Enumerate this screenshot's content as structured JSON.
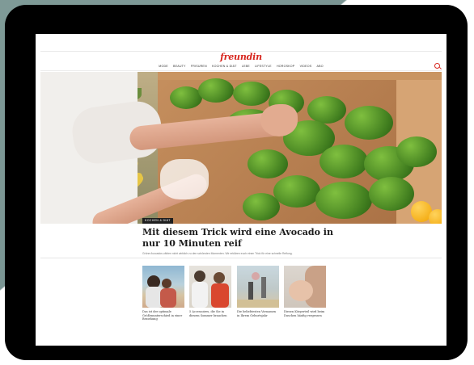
{
  "site": {
    "logo": "freundin",
    "nav": [
      "MODE",
      "BEAUTY",
      "FRISUREN",
      "KOCHEN & DIÄT",
      "LEBE",
      "LIFESTYLE",
      "HOROSKOP",
      "VIDEOS",
      "ABO"
    ]
  },
  "article": {
    "category": "KOCHEN & DIÄT",
    "headline": "Mit diesem Trick wird eine Avocado in nur 10 Minuten reif",
    "teaser": "Grüne Avocados zählen nicht wirklich zu den schönsten Momenten. Wir erklären euch einen Trick für eine schnelle Reifung."
  },
  "cards": [
    {
      "caption": "Das ist der optimale Größenunterschied in einer Beziehung"
    },
    {
      "caption": "5 Accessoires, die Sie in diesem Sommer brauchen"
    },
    {
      "caption": "Die beliebtesten Vornamen in Ihrem Geburtsjahr"
    },
    {
      "caption": "Diesen Körperteil wird beim Duschen häufig vergessen"
    }
  ],
  "colors": {
    "brand": "#d7261e",
    "frame": "#000000",
    "accent_bg": "#7f9a97"
  }
}
